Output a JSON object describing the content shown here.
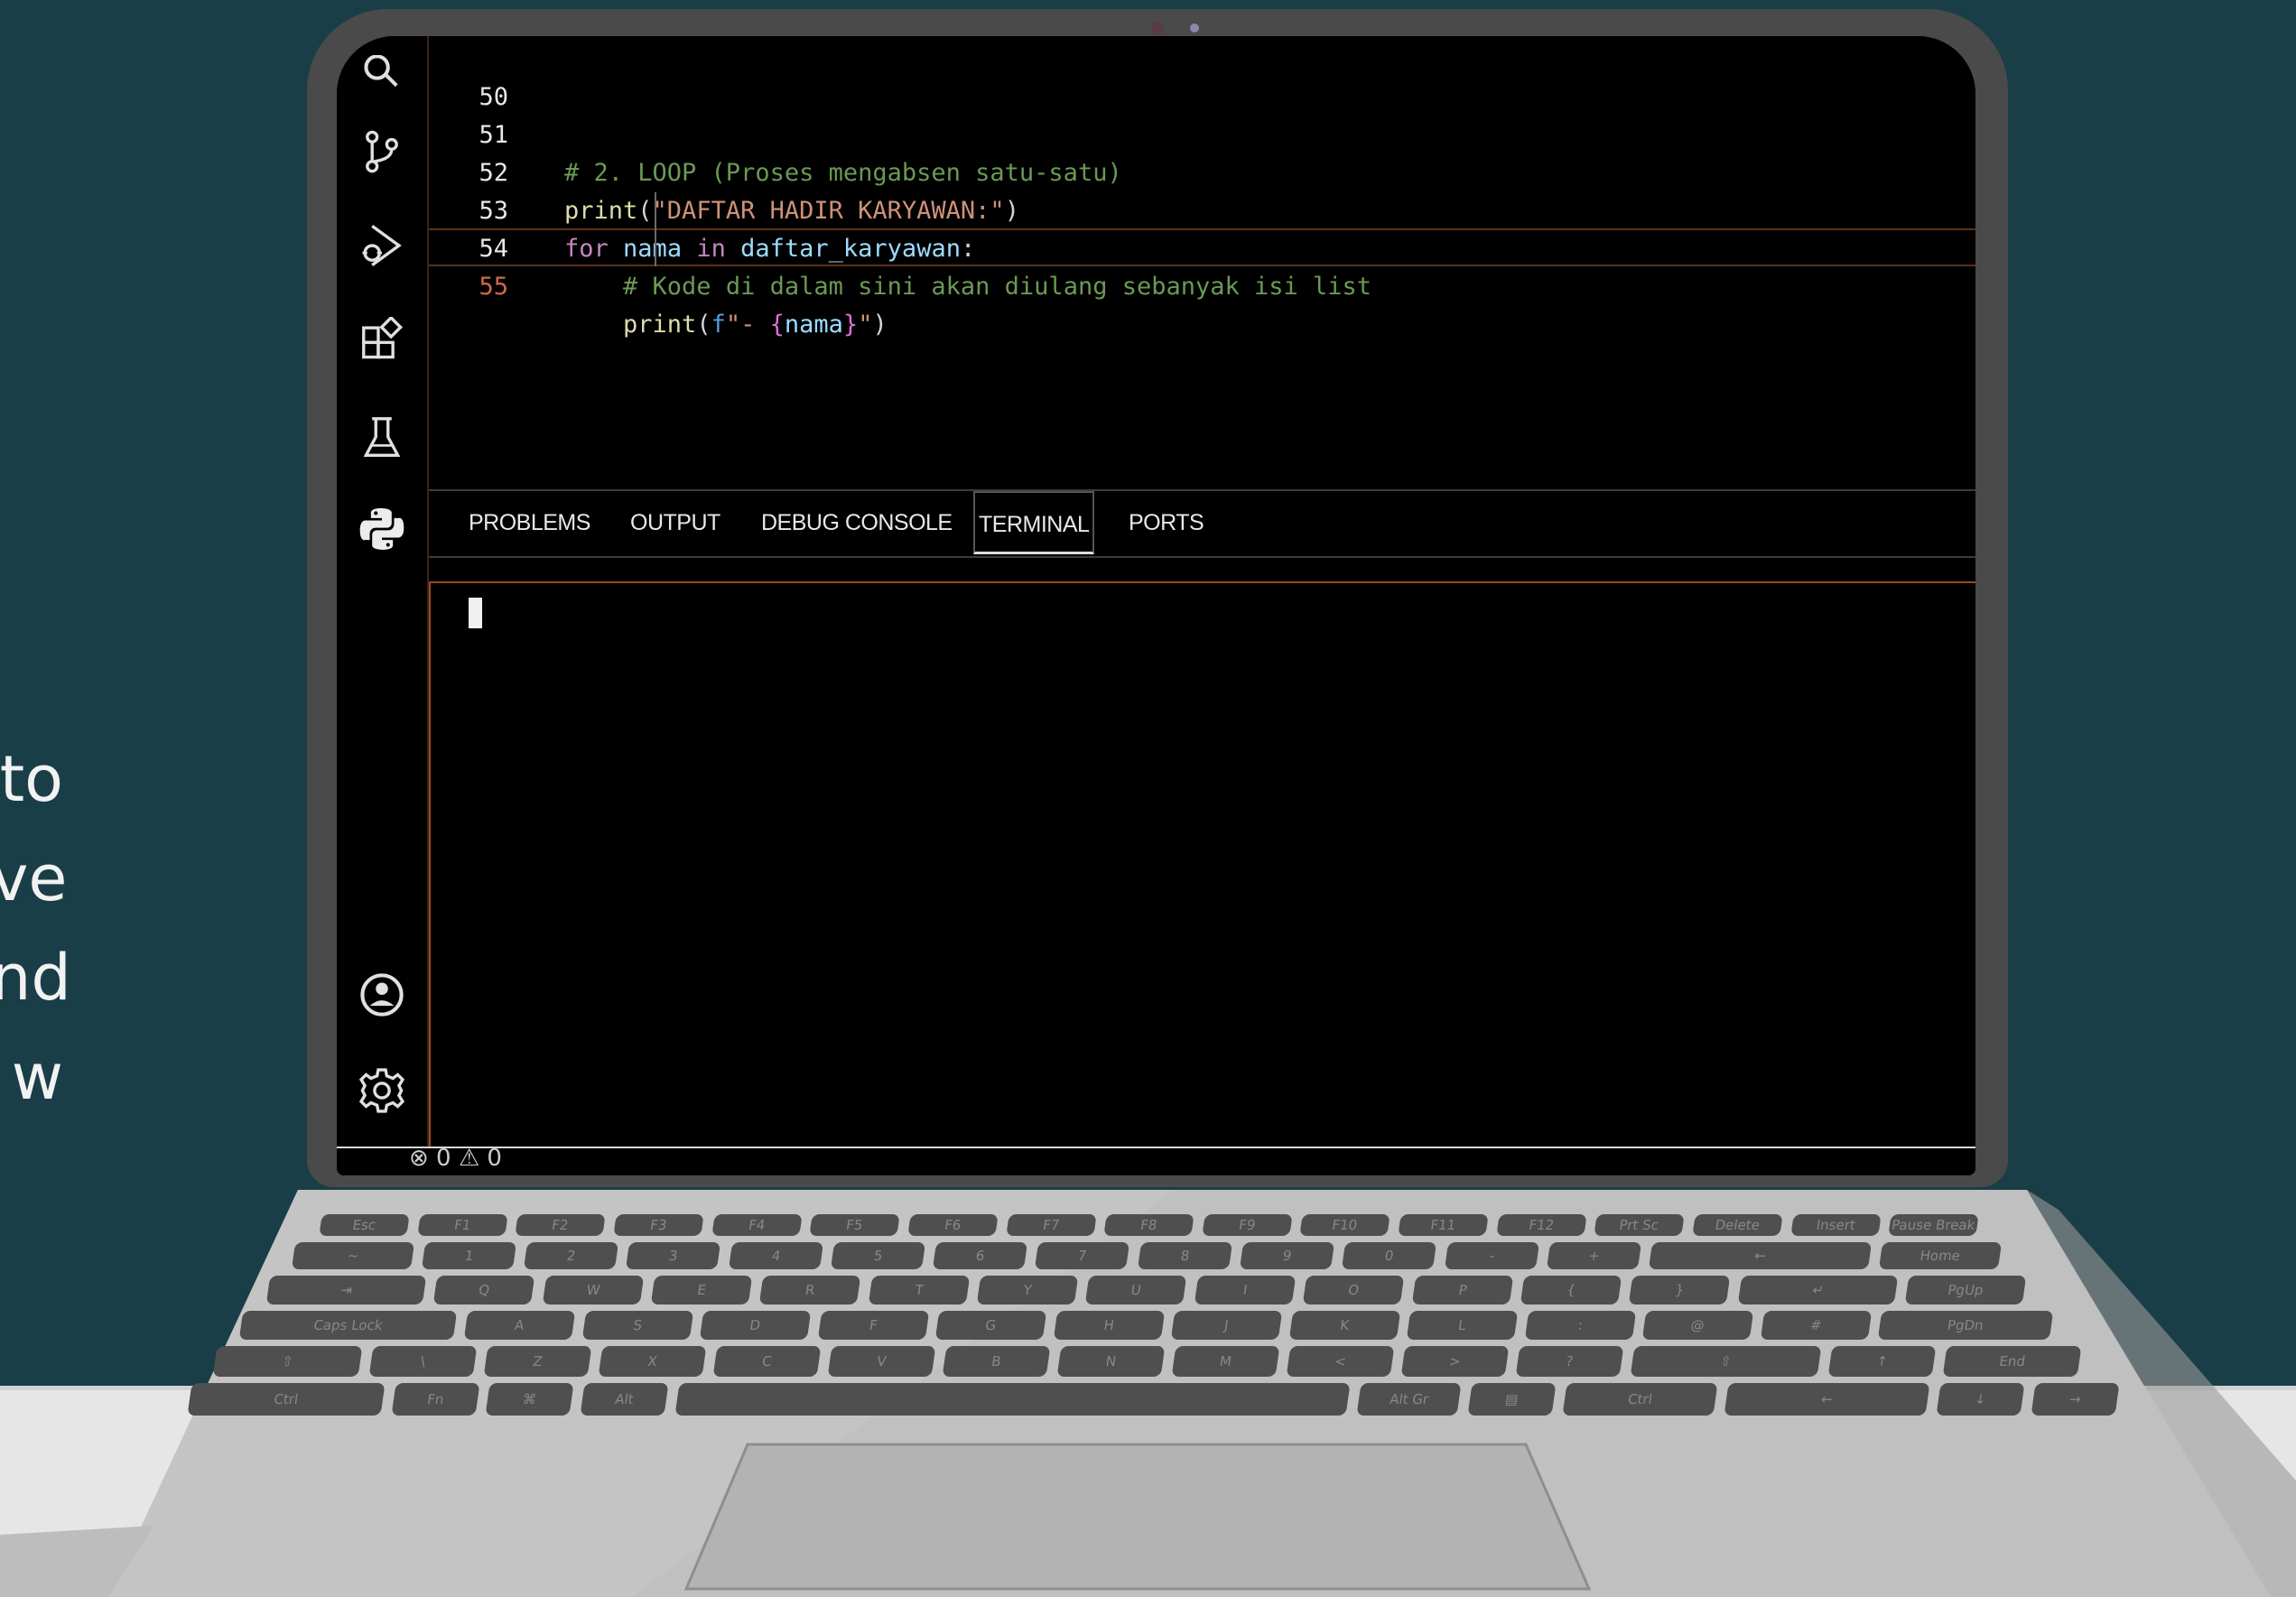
{
  "side_text": [
    "to",
    "ve",
    "nd",
    "w"
  ],
  "activity_bar": {
    "icons": [
      "search-icon",
      "source-control-icon",
      "run-debug-icon",
      "extensions-icon",
      "testing-icon",
      "python-icon",
      "account-icon",
      "settings-gear-icon"
    ]
  },
  "editor": {
    "lines": [
      {
        "num": "50",
        "tokens": []
      },
      {
        "num": "51",
        "tokens": [
          {
            "t": "cm",
            "v": "# 2. LOOP (Proses mengabsen satu-satu)"
          }
        ]
      },
      {
        "num": "52",
        "tokens": [
          {
            "t": "fn",
            "v": "print"
          },
          {
            "t": "pl",
            "v": "("
          },
          {
            "t": "st",
            "v": "\"DAFTAR HADIR KARYAWAN:\""
          },
          {
            "t": "pl",
            "v": ")"
          }
        ]
      },
      {
        "num": "53",
        "tokens": [
          {
            "t": "kw",
            "v": "for"
          },
          {
            "t": "pl",
            "v": " "
          },
          {
            "t": "vr",
            "v": "nama"
          },
          {
            "t": "pl",
            "v": " "
          },
          {
            "t": "kw",
            "v": "in"
          },
          {
            "t": "pl",
            "v": " "
          },
          {
            "t": "vr",
            "v": "daftar_karyawan"
          },
          {
            "t": "pl",
            "v": ":"
          }
        ]
      },
      {
        "num": "54",
        "tokens": [
          {
            "t": "pl",
            "v": "    "
          },
          {
            "t": "cm",
            "v": "# Kode di dalam sini akan diulang sebanyak isi list"
          }
        ]
      },
      {
        "num": "55",
        "tokens": [
          {
            "t": "pl",
            "v": "    "
          },
          {
            "t": "fn",
            "v": "print"
          },
          {
            "t": "pl",
            "v": "("
          },
          {
            "t": "bl",
            "v": "f"
          },
          {
            "t": "st",
            "v": "\"- "
          },
          {
            "t": "br2",
            "v": "{"
          },
          {
            "t": "vr",
            "v": "nama"
          },
          {
            "t": "br2",
            "v": "}"
          },
          {
            "t": "st",
            "v": "\""
          },
          {
            "t": "pl",
            "v": ")"
          }
        ]
      }
    ],
    "active_line": "55"
  },
  "panel": {
    "tabs": [
      {
        "label": "PROBLEMS",
        "active": false
      },
      {
        "label": "OUTPUT",
        "active": false
      },
      {
        "label": "DEBUG CONSOLE",
        "active": false
      },
      {
        "label": "TERMINAL",
        "active": true
      },
      {
        "label": "PORTS",
        "active": false
      }
    ]
  },
  "status_bar": {
    "text": "⊗ 0 ⚠ 0"
  },
  "keyboard": {
    "rows": [
      [
        "Esc",
        "F1",
        "F2",
        "F3",
        "F4",
        "F5",
        "F6",
        "F7",
        "F8",
        "F9",
        "F10",
        "F11",
        "F12",
        "Prt Sc",
        "Delete",
        "Insert",
        "Pause Break"
      ],
      [
        "~",
        "1",
        "2",
        "3",
        "4",
        "5",
        "6",
        "7",
        "8",
        "9",
        "0",
        "-",
        "+",
        "←",
        "Home"
      ],
      [
        "⇥",
        "Q",
        "W",
        "E",
        "R",
        "T",
        "Y",
        "U",
        "I",
        "O",
        "P",
        "{",
        "}",
        "↵",
        "PgUp"
      ],
      [
        "Caps Lock",
        "A",
        "S",
        "D",
        "F",
        "G",
        "H",
        "J",
        "K",
        "L",
        ":",
        "@",
        "#",
        "PgDn"
      ],
      [
        "⇧",
        "\\",
        "Z",
        "X",
        "C",
        "V",
        "B",
        "N",
        "M",
        "<",
        ">",
        "?",
        "⇧",
        "↑",
        "End"
      ],
      [
        "Ctrl",
        "Fn",
        "⌘",
        "Alt",
        "",
        "Alt Gr",
        "▤",
        "Ctrl",
        "←",
        "↓",
        "→"
      ]
    ]
  },
  "colors": {
    "background": "#1a3e47",
    "laptop_body": "#c4c4c4",
    "key": "#4f4f4f",
    "accent_border": "#9a4a20"
  }
}
